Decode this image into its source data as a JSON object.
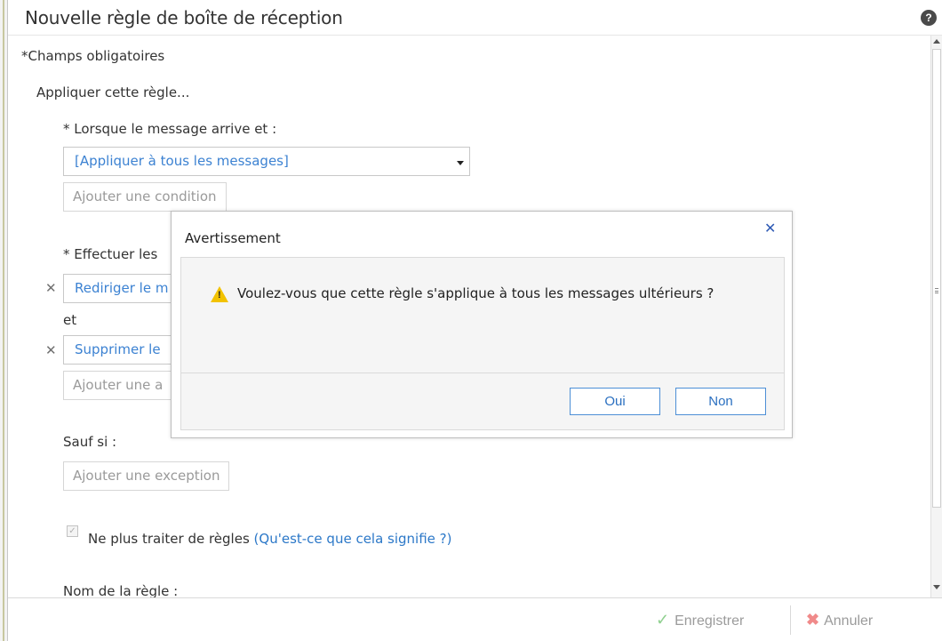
{
  "window": {
    "title": "Nouvelle règle de boîte de réception",
    "help_icon": "question-circle-icon",
    "help_glyph": "?"
  },
  "form": {
    "required_note": "*Champs obligatoires",
    "apply_rule_label": "Appliquer cette règle...",
    "when_label": "* Lorsque le message arrive et :",
    "condition_value": "[Appliquer à tous les messages]",
    "add_condition": "Ajouter une condition",
    "do_label_partial": "* Effectuer les",
    "action1_partial": "Rediriger le m",
    "and_label": "et",
    "action2_partial": "Supprimer le",
    "add_action_partial": "Ajouter une a",
    "except_label": "Sauf si :",
    "add_exception": "Ajouter une exception",
    "stop_processing_label": "Ne plus traiter de règles",
    "stop_processing_checked": true,
    "what_does_this_mean_link": "(Qu'est-ce que cela signifie ?)",
    "rule_name_label": "Nom de la règle :",
    "remove_glyph": "✕",
    "check_glyph": "✓"
  },
  "footer": {
    "save_label": "Enregistrer",
    "cancel_label": "Annuler",
    "save_icon": "checkmark-icon",
    "cancel_icon": "red-x-icon",
    "check_glyph": "✓",
    "x_glyph": "✖"
  },
  "dialog": {
    "title": "Avertissement",
    "message": "Voulez-vous que cette règle s'applique à tous les messages ultérieurs ?",
    "yes_label": "Oui",
    "no_label": "Non",
    "close_glyph": "✕",
    "warning_glyph": "!",
    "warning_color": "#f2c200"
  },
  "colors": {
    "link_blue": "#3c82d2",
    "dialog_button_border": "#4d8fd6"
  }
}
